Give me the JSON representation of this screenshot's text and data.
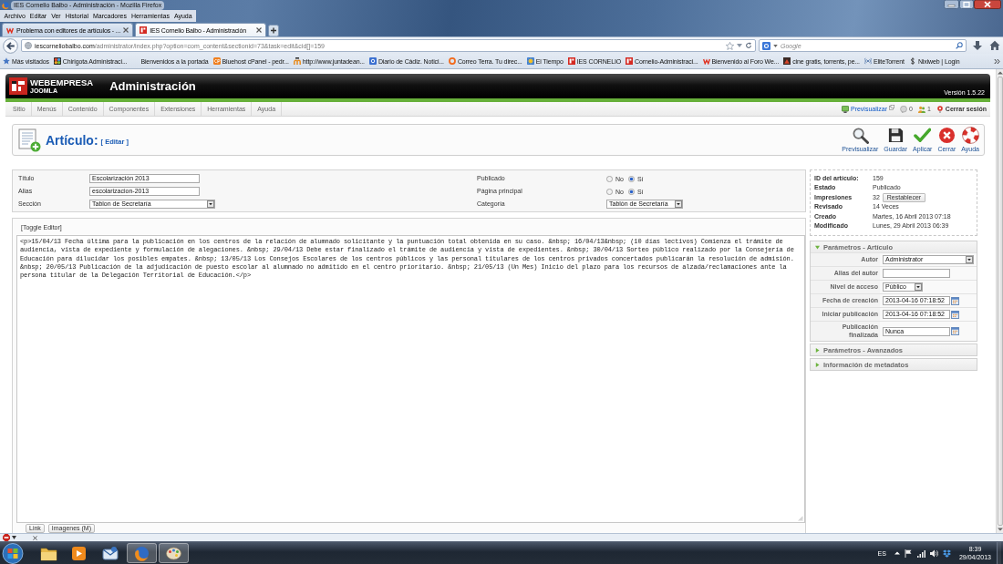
{
  "window": {
    "title": "IES Cornelio Balbo - Administración - Mozilla Firefox"
  },
  "menu_bar": [
    "Archivo",
    "Editar",
    "Ver",
    "Historial",
    "Marcadores",
    "Herramientas",
    "Ayuda"
  ],
  "tabs": [
    {
      "label": "Problema con editores de artículos - ...",
      "kind": "w",
      "selected": false
    },
    {
      "label": "IES Cornelio Balbo - Administración",
      "kind": "logo",
      "selected": true
    }
  ],
  "address_bar": {
    "domain": "iescorneliobalbo.com",
    "path": "/administrator/index.php?option=com_content&sectionid=73&task=edit&cid[]=159"
  },
  "search": {
    "placeholder": "Google"
  },
  "bookmarks": [
    {
      "label": "Más visitados",
      "kind": "star"
    },
    {
      "label": "Chirigota Administraci...",
      "kind": "pinwheel"
    },
    {
      "label": "Bienvenidos a la portada",
      "kind": "blank"
    },
    {
      "label": "Bluehost cPanel - pedr...",
      "kind": "tile"
    },
    {
      "label": "http://www.juntadean...",
      "kind": "arches"
    },
    {
      "label": "Diario de Cádiz. Notici...",
      "kind": "square"
    },
    {
      "label": "Correo Terra. Tu direc...",
      "kind": "ring"
    },
    {
      "label": "El Tiempo",
      "kind": "sun"
    },
    {
      "label": "IES CORNELIO",
      "kind": "logo"
    },
    {
      "label": "Cornelio-Administraci...",
      "kind": "logo"
    },
    {
      "label": "Bienvenido al Foro We...",
      "kind": "w"
    },
    {
      "label": "cine gratis, torrents, pe...",
      "kind": "thumbnail"
    },
    {
      "label": "EliteTorrent",
      "kind": "broadcast"
    },
    {
      "label": "Nixiweb | Login",
      "kind": "dollar"
    }
  ],
  "admin_header": {
    "logo_top": "WEBEMPRESA",
    "logo_bottom": "JOOMLA",
    "title": "Administración",
    "version": "Versión 1.5.22"
  },
  "admin_menu": [
    "Sitio",
    "Menús",
    "Contenido",
    "Componentes",
    "Extensiones",
    "Herramientas",
    "Ayuda"
  ],
  "status": [
    {
      "kind": "preview",
      "label": "Previsualizar"
    },
    {
      "kind": "messages",
      "label": "0"
    },
    {
      "kind": "users",
      "label": "1"
    },
    {
      "kind": "logout",
      "label": "Cerrar sesión"
    }
  ],
  "toolbar": {
    "title": "Artículo:",
    "subtitle": "[ Editar ]",
    "buttons": [
      {
        "kind": "preview",
        "label": "Previsualizar"
      },
      {
        "kind": "save",
        "label": "Guardar"
      },
      {
        "kind": "apply",
        "label": "Aplicar"
      },
      {
        "kind": "close",
        "label": "Cerrar"
      },
      {
        "kind": "help",
        "label": "Ayuda"
      }
    ]
  },
  "details": {
    "fields": [
      {
        "kind": "text",
        "label": "Título",
        "value": "Escolarización 2013"
      },
      {
        "kind": "text",
        "label": "Alias",
        "value": "escolarizacion-2013"
      },
      {
        "kind": "select",
        "label": "Sección",
        "value": "Tablon de Secretaría"
      }
    ],
    "options": [
      {
        "kind": "radio",
        "label": "Publicado",
        "choices": [
          {
            "label": "No",
            "selected": false
          },
          {
            "label": "Sí",
            "selected": true
          }
        ]
      },
      {
        "kind": "radio",
        "label": "Página principal",
        "choices": [
          {
            "label": "No",
            "selected": false
          },
          {
            "label": "Sí",
            "selected": true
          }
        ]
      },
      {
        "kind": "select",
        "label": "Categoría",
        "value": "Tablón de Secretaría"
      }
    ]
  },
  "editor": {
    "toggle": "[Toggle Editor]",
    "content": "<p>15/04/13 Fecha última para la publicación en los centros de la relación de alumnado solicitante y la puntuación total obtenida en su caso. &nbsp; 16/04/13&nbsp; (10 días lectivos) Comienza el trámite de audiencia, vista de expediente y formulación de alegaciones. &nbsp; 29/04/13 Debe estar finalizado el trámite de audiencia y vista de expedientes. &nbsp; 30/04/13 Sorteo público realizado por la Consejería de Educación para dilucidar los posibles empates. &nbsp; 13/05/13 Los Consejos Escolares de los centros públicos y las personal titulares de los centros privados concertados publicarán la resolución de admisión. &nbsp; 20/05/13 Publicación de la adjudicación de puesto escolar al alumnado no admitido en el centro prioritario. &nbsp; 21/05/13 (Un Mes) Inicio del plazo para los recursos de alzada/reclamaciones ante la persona titular de la Delegación Territorial de Educación.</p>",
    "buttons": [
      "Link",
      "Imagenes (M)"
    ]
  },
  "info": [
    {
      "label": "ID del artículo:",
      "value": "159"
    },
    {
      "label": "Estado",
      "value": "Publicado"
    },
    {
      "label": "Impresiones",
      "value": "32",
      "button": "Restablecer"
    },
    {
      "label": "Revisado",
      "value": "14 Veces"
    },
    {
      "label": "Creado",
      "value": "Martes, 16 Abril 2013 07:18"
    },
    {
      "label": "Modificado",
      "value": "Lunes, 29 Abril 2013 06:39"
    }
  ],
  "parameters": [
    {
      "title": "Parámetros - Artículo",
      "expanded": true,
      "rows": [
        {
          "kind": "select",
          "label": "Autor",
          "value": "Administrator"
        },
        {
          "kind": "text",
          "label": "Alias del autor"
        },
        {
          "kind": "select",
          "label": "Nivel de acceso",
          "value": "Público"
        },
        {
          "kind": "date",
          "label": "Fecha de creación",
          "value": "2013-04-16 07:18:52"
        },
        {
          "kind": "date",
          "label": "Iniciar publicación",
          "value": "2013-04-16 07:18:52"
        },
        {
          "kind": "date",
          "label": "Publicación finalizada",
          "value": "Nunca"
        }
      ]
    },
    {
      "title": "Parámetros - Avanzados",
      "expanded": false
    },
    {
      "title": "Información de metadatos",
      "expanded": false
    }
  ],
  "taskbar": {
    "apps": [
      {
        "kind": "folder",
        "running": false
      },
      {
        "kind": "media",
        "running": false
      },
      {
        "kind": "mail",
        "running": false
      },
      {
        "kind": "browser",
        "running": true
      },
      {
        "kind": "paint",
        "running": true
      }
    ],
    "language": "ES",
    "time": "8:39",
    "date": "29/04/2013"
  }
}
